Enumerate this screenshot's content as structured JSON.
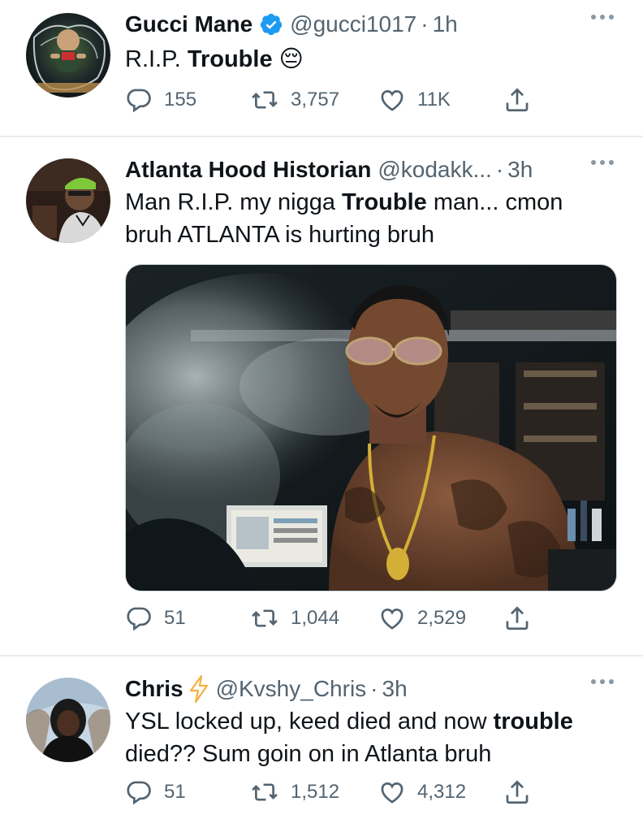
{
  "tweets": [
    {
      "name": "Gucci Mane",
      "verified": true,
      "handle": "@gucci1017",
      "time": "1h",
      "text_before": "R.I.P. ",
      "text_bold": "Trouble",
      "text_after": " ",
      "emoji": "😔",
      "replies": "155",
      "retweets": "3,757",
      "likes": "11K"
    },
    {
      "name": "Atlanta Hood Historian",
      "handle": "@kodakk...",
      "time": "3h",
      "text_line1_before": "Man R.I.P. my nigga ",
      "text_bold": "Trouble",
      "text_line1_after": " man... cmon",
      "text_line2": "bruh ATLANTA is hurting bruh",
      "replies": "51",
      "retweets": "1,044",
      "likes": "2,529"
    },
    {
      "name": "Chris",
      "handle": "@Kvshy_Chris",
      "time": "3h",
      "text_line1_before": "YSL locked up, keed died and now ",
      "text_bold": "trouble",
      "text_line2": "died?? Sum goin on in Atlanta bruh",
      "replies": "51",
      "retweets": "1,512",
      "likes": "4,312"
    }
  ],
  "header_separator": "·",
  "colors": {
    "text": "#0f1419",
    "secondary": "#536471",
    "verified": "#1d9bf0",
    "bolt": "#f5b042",
    "divider": "#e6ecf0"
  },
  "icons": [
    "reply-icon",
    "retweet-icon",
    "like-icon",
    "share-icon",
    "more-icon",
    "verified-badge-icon",
    "lightning-bolt-icon"
  ]
}
